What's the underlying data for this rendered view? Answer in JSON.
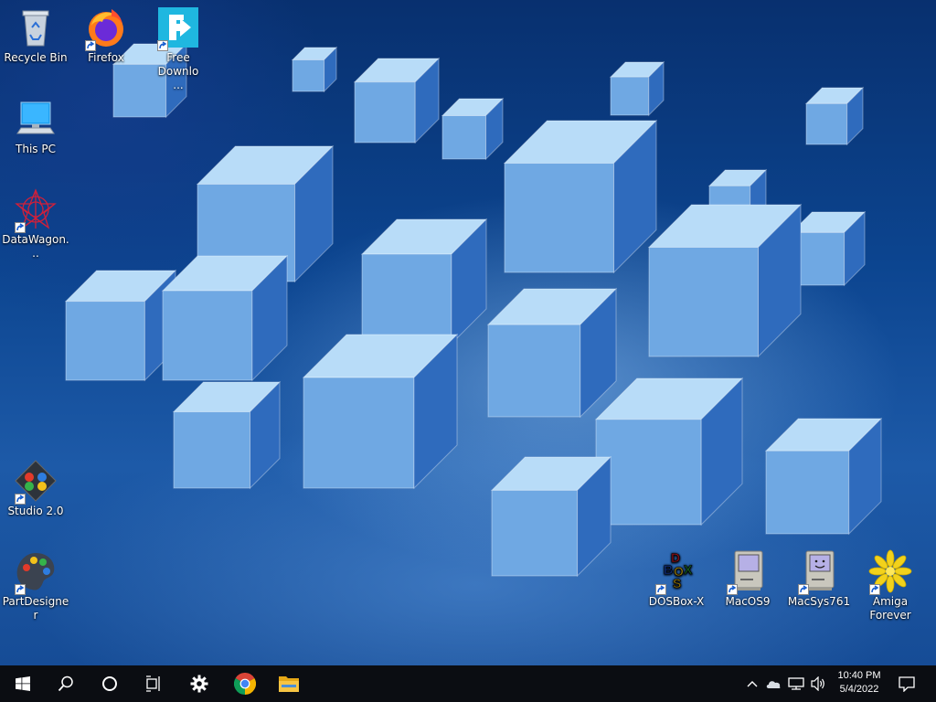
{
  "desktop": {
    "icons": [
      {
        "label": "Recycle Bin",
        "icon": "recycle-bin-icon",
        "shortcut": false
      },
      {
        "label": "Firefox",
        "icon": "firefox-icon",
        "shortcut": true
      },
      {
        "label": "Free Downlo...",
        "icon": "free-download-manager-icon",
        "shortcut": true
      },
      {
        "label": "This PC",
        "icon": "this-pc-icon",
        "shortcut": false
      },
      {
        "label": "DataWagon...",
        "icon": "datawagon-icon",
        "shortcut": true
      },
      {
        "label": "Studio 2.0",
        "icon": "studio-icon",
        "shortcut": true
      },
      {
        "label": "PartDesigner",
        "icon": "partdesigner-icon",
        "shortcut": true
      },
      {
        "label": "DOSBox-X",
        "icon": "dosbox-icon",
        "shortcut": true
      },
      {
        "label": "MacOS9",
        "icon": "macos9-icon",
        "shortcut": true
      },
      {
        "label": "MacSys761",
        "icon": "macsys761-icon",
        "shortcut": true
      },
      {
        "label": "Amiga Forever",
        "icon": "amiga-forever-icon",
        "shortcut": true
      }
    ],
    "wallpaper": {
      "primary": "#0c4590",
      "cube_light": "#b8dcf8",
      "cube_mid": "#6fa8e3",
      "cube_dark": "#2f6bbd"
    }
  },
  "taskbar": {
    "background": "#0b0d12",
    "buttons": [
      {
        "name": "start",
        "icon": "windows-logo-icon"
      },
      {
        "name": "search",
        "icon": "search-icon"
      },
      {
        "name": "cortana",
        "icon": "cortana-icon"
      },
      {
        "name": "task-view",
        "icon": "task-view-icon"
      },
      {
        "name": "settings",
        "icon": "gear-icon"
      },
      {
        "name": "chrome",
        "icon": "chrome-icon"
      },
      {
        "name": "file-explorer",
        "icon": "folder-icon"
      }
    ],
    "tray": {
      "icons": [
        "chevron-up-icon",
        "onedrive-icon",
        "network-icon",
        "volume-icon"
      ],
      "time": "10:40 PM",
      "date": "5/4/2022",
      "notification_icon": "action-center-icon"
    }
  }
}
